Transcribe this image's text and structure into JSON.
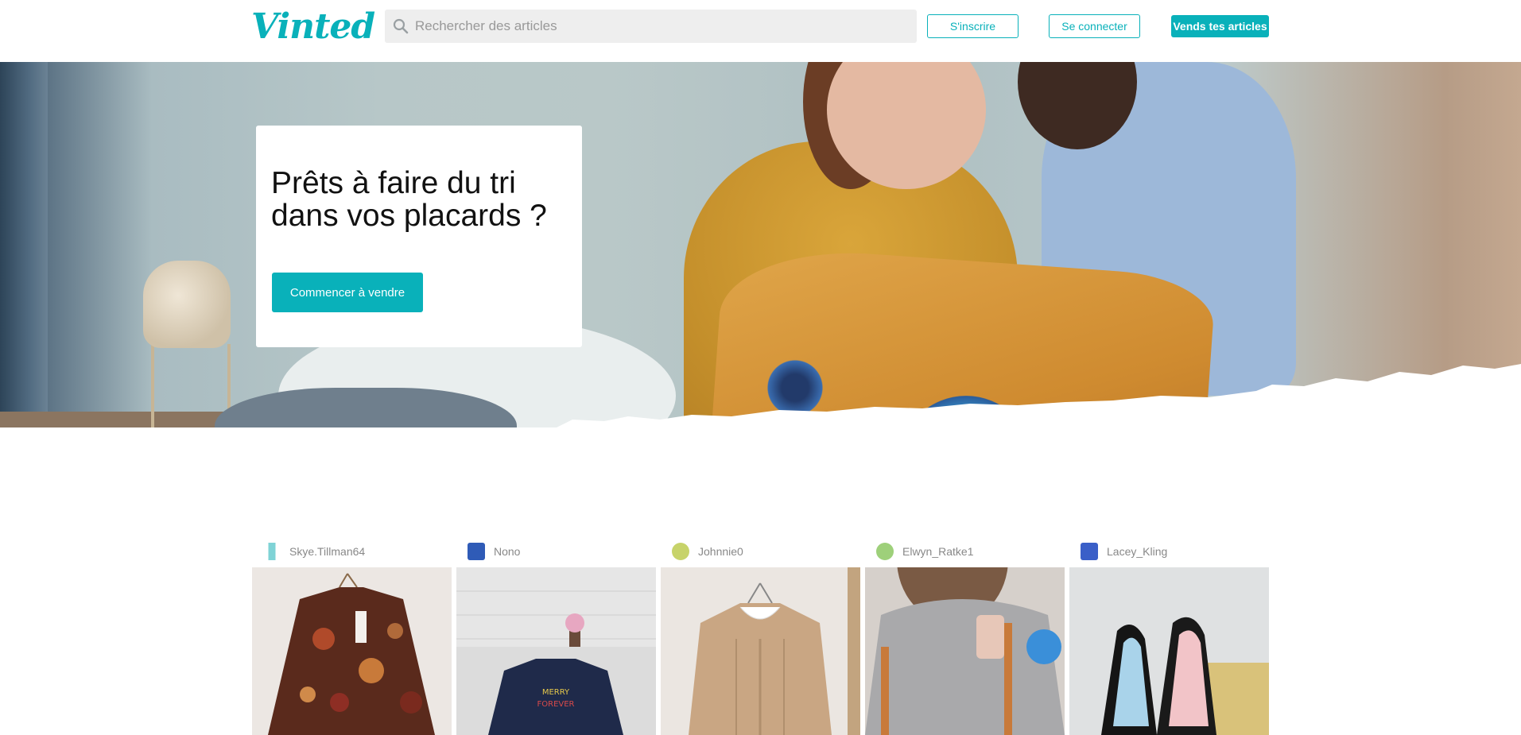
{
  "header": {
    "logo": "Vinted",
    "search_placeholder": "Rechercher des articles",
    "signup_label": "S'inscrire",
    "login_label": "Se connecter",
    "sell_label": "Vends tes articles"
  },
  "hero": {
    "title": "Prêts à faire du tri dans vos placards ?",
    "cta_label": "Commencer à vendre"
  },
  "feed": {
    "items": [
      {
        "username": "Skye.Tillman64",
        "avatar_color": "#7fd3d6",
        "photo_icon": "blouse-photo"
      },
      {
        "username": "Nono",
        "avatar_color": "#2f5bb7",
        "photo_icon": "tshirt-photo"
      },
      {
        "username": "Johnnie0",
        "avatar_color": "#c7d36a",
        "photo_icon": "sweater-photo"
      },
      {
        "username": "Elwyn_Ratke1",
        "avatar_color": "#9ed07a",
        "photo_icon": "top-photo"
      },
      {
        "username": "Lacey_Kling",
        "avatar_color": "#3a5fc8",
        "photo_icon": "heels-photo"
      }
    ]
  },
  "colors": {
    "brand": "#09b1ba"
  }
}
